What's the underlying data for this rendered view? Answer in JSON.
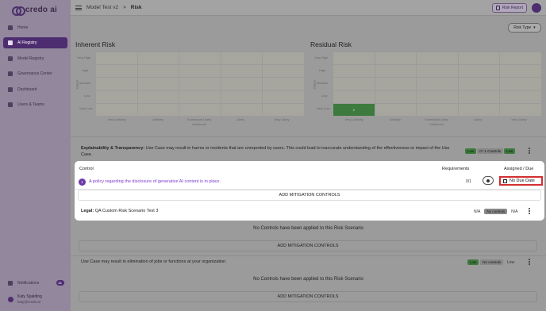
{
  "sidebar": {
    "logo_text": "credo ai",
    "items": [
      {
        "label": "Home",
        "icon": "home-icon"
      },
      {
        "label": "AI Registry",
        "icon": "registry-icon",
        "active": true
      },
      {
        "label": "Model Registry",
        "icon": "model-icon"
      },
      {
        "label": "Governance Center",
        "icon": "shield-icon"
      },
      {
        "label": "Dashboard",
        "icon": "dashboard-icon"
      },
      {
        "label": "Users & Teams",
        "icon": "users-icon"
      }
    ],
    "notifications": {
      "label": "Notifications",
      "count": "81"
    },
    "user": {
      "name": "Katy Spalding",
      "email": "katy@credo.ai"
    }
  },
  "topbar": {
    "breadcrumb_parent": "Model Test v2",
    "breadcrumb_sep": ">",
    "breadcrumb_current": "Risk",
    "risk_report_label": "Risk Report"
  },
  "main": {
    "risk_type_label": "Risk Type",
    "inherent": {
      "title": "Inherent Risk",
      "y_labels": [
        "Very High",
        "High",
        "Medium",
        "Low",
        "Very Low"
      ],
      "y_axis": "Impact",
      "x_labels": [
        "Very Unlikely",
        "Unlikely",
        "Somewhat Likely",
        "Likely",
        "Very Likely"
      ],
      "x_axis": "Likelihood"
    },
    "residual": {
      "title": "Residual Risk",
      "y_labels": [
        "Very High",
        "High",
        "Medium",
        "Low",
        "Very Low"
      ],
      "y_axis": "Impact",
      "x_labels": [
        "Very Unlikely",
        "Unlikely",
        "Somewhat Likely",
        "Likely",
        "Very Likely"
      ],
      "x_axis": "Likelihood",
      "highlight_value": "2"
    },
    "scenario1": {
      "title_bold": "Explainability & Transparency:",
      "text": " Use Case may result in harms or incidents that are unreported by users. This could lead to inaccurate understanding of the effectiveness or impact of the Use Case.",
      "inherent": "Low",
      "controls": "0 / 1 Controls",
      "residual": "Low"
    },
    "card": {
      "col_control": "Control",
      "col_requirements": "Requirements",
      "col_assigned": "Assigned / Due",
      "row_number": "1",
      "control_text": "A policy regarding the disclosure of generative AI content is in place.",
      "requirements": "0/1",
      "due_label": "No Due Date",
      "add_label": "ADD MITIGATION CONTROLS"
    },
    "scenario2": {
      "title_bold": "Legal:",
      "text": " QA Custom Risk Scenario Test 3",
      "inherent": "N/A",
      "controls": "No controls",
      "residual": "N/A",
      "empty_text": "No Controls have been applied to this Risk Scenario",
      "add_label": "ADD MITIGATION CONTROLS"
    },
    "scenario3": {
      "text": "Use Case may result in elimination of jobs or functions at your organization.",
      "inherent": "Low",
      "controls": "No controls",
      "residual": "Low",
      "empty_text": "No Controls have been applied to this Risk Scenario",
      "add_label": "ADD MITIGATION CONTROLS"
    }
  }
}
